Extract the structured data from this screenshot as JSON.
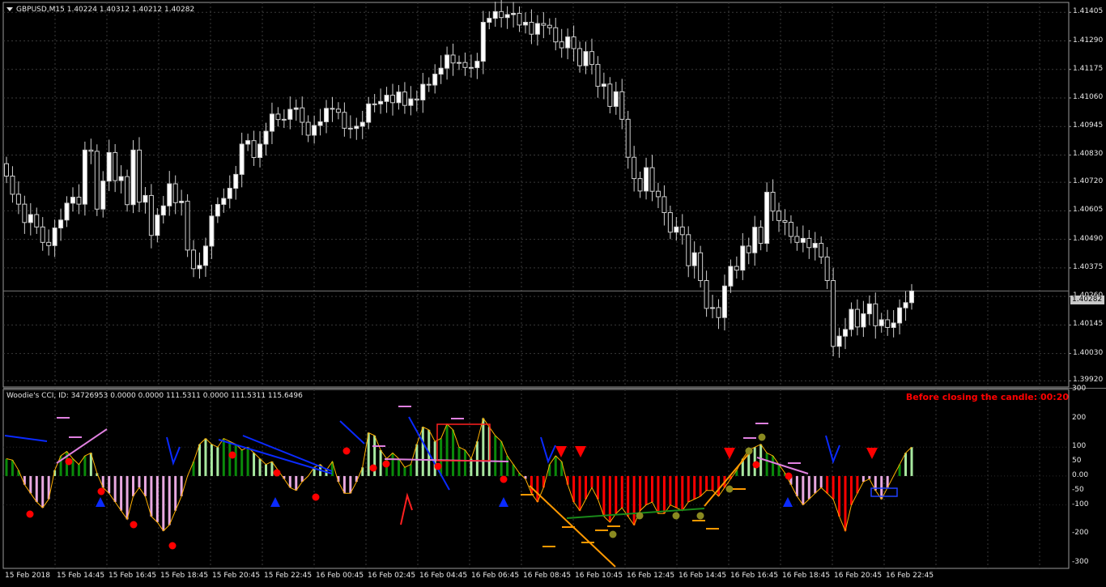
{
  "main_chart": {
    "title": "GBPUSD,M15  1.40224 1.40312 1.40212 1.40282",
    "current_price": "1.40282",
    "price_ticks": [
      "1.41405",
      "1.41290",
      "1.41175",
      "1.41060",
      "1.40945",
      "1.40830",
      "1.40720",
      "1.40605",
      "1.40490",
      "1.40375",
      "1.40260",
      "1.40145",
      "1.40030",
      "1.39920"
    ]
  },
  "indicator": {
    "title": "Woodie's CCI, ID: 34726953 0.0000 0.0000 111.5311 0.0000 111.5311 115.6496",
    "warning": "Before closing the candle: 00:20",
    "ticks": [
      "300",
      "200",
      "100",
      "50",
      "0.00",
      "-50",
      "-100",
      "-200",
      "-300"
    ]
  },
  "time_axis": [
    "15 Feb 2018",
    "15 Feb 14:45",
    "15 Feb 16:45",
    "15 Feb 18:45",
    "15 Feb 20:45",
    "15 Feb 22:45",
    "16 Feb 00:45",
    "16 Feb 02:45",
    "16 Feb 04:45",
    "16 Feb 06:45",
    "16 Feb 08:45",
    "16 Feb 10:45",
    "16 Feb 12:45",
    "16 Feb 14:45",
    "16 Feb 16:45",
    "16 Feb 18:45",
    "16 Feb 20:45",
    "16 Feb 22:45"
  ],
  "colors": {
    "bull": "#ffffff",
    "bear": "#000000",
    "grid": "#3a3a3a",
    "green": "#0a8a0a",
    "lightgreen": "#a8e8a0",
    "pink": "#e8a8e0",
    "red": "#ff0000",
    "orange": "#ff9900",
    "blue": "#0a2aff",
    "cci_line": "#ffb000"
  },
  "chart_data": {
    "type": "candlestick",
    "close": [
      1.40745,
      1.40672,
      1.40632,
      1.40558,
      1.4059,
      1.4054,
      1.40478,
      1.40465,
      1.40536,
      1.40568,
      1.40636,
      1.4066,
      1.40632,
      1.4085,
      1.40845,
      1.40612,
      1.40725,
      1.4084,
      1.40727,
      1.40743,
      1.4063,
      1.4085,
      1.4064,
      1.40667,
      1.40506,
      1.40588,
      1.40625,
      1.40714,
      1.40638,
      1.40644,
      1.40447,
      1.40372,
      1.40385,
      1.40463,
      1.40584,
      1.40631,
      1.40655,
      1.40696,
      1.40752,
      1.40874,
      1.40888,
      1.4082,
      1.40874,
      1.40926,
      1.40995,
      1.40973,
      1.40974,
      1.41014,
      1.4102,
      1.40962,
      1.4091,
      1.40949,
      1.40964,
      1.41018,
      1.41015,
      1.41002,
      1.40938,
      1.40937,
      1.40946,
      1.40962,
      1.41036,
      1.41036,
      1.41046,
      1.41071,
      1.41041,
      1.41084,
      1.4103,
      1.41056,
      1.41052,
      1.41115,
      1.41112,
      1.41156,
      1.4118,
      1.41233,
      1.41201,
      1.41203,
      1.41183,
      1.41182,
      1.41208,
      1.41365,
      1.41381,
      1.41408,
      1.41384,
      1.41396,
      1.41401,
      1.41354,
      1.41365,
      1.41317,
      1.4136,
      1.41353,
      1.41343,
      1.41286,
      1.41262,
      1.41306,
      1.41259,
      1.4119,
      1.41247,
      1.41195,
      1.41107,
      1.41116,
      1.41026,
      1.41085,
      1.40974,
      1.40821,
      1.40735,
      1.40685,
      1.40779,
      1.40684,
      1.40662,
      1.40598,
      1.40519,
      1.4054,
      1.40509,
      1.40384,
      1.40436,
      1.40324,
      1.40212,
      1.40215,
      1.40175,
      1.40302,
      1.40381,
      1.40366,
      1.40463,
      1.40436,
      1.40539,
      1.40474,
      1.4068,
      1.40604,
      1.40566,
      1.40559,
      1.40502,
      1.40478,
      1.40494,
      1.40457,
      1.40474,
      1.40419,
      1.40324,
      1.40059,
      1.401,
      1.40127,
      1.40208,
      1.40137,
      1.4019,
      1.4023,
      1.40142,
      1.40166,
      1.40135,
      1.40153,
      1.40214,
      1.40235,
      1.40282
    ],
    "open": [
      1.40795,
      1.40745,
      1.40672,
      1.40632,
      1.40558,
      1.4059,
      1.4054,
      1.40478,
      1.40465,
      1.40536,
      1.40568,
      1.40636,
      1.4066,
      1.40632,
      1.4085,
      1.40845,
      1.40612,
      1.40725,
      1.4084,
      1.40727,
      1.40743,
      1.4063,
      1.4085,
      1.4064,
      1.40667,
      1.40506,
      1.40588,
      1.40625,
      1.40714,
      1.40638,
      1.40644,
      1.40447,
      1.40372,
      1.40385,
      1.40463,
      1.40584,
      1.40631,
      1.40655,
      1.40696,
      1.40752,
      1.40874,
      1.40888,
      1.4082,
      1.40874,
      1.40926,
      1.40995,
      1.40973,
      1.40974,
      1.41014,
      1.4102,
      1.40962,
      1.4091,
      1.40949,
      1.40964,
      1.41018,
      1.41015,
      1.41002,
      1.40938,
      1.40937,
      1.40946,
      1.40962,
      1.41036,
      1.41036,
      1.41046,
      1.41071,
      1.41041,
      1.41084,
      1.4103,
      1.41056,
      1.41052,
      1.41115,
      1.41112,
      1.41156,
      1.4118,
      1.41233,
      1.41201,
      1.41203,
      1.41183,
      1.41182,
      1.41208,
      1.41365,
      1.41381,
      1.41408,
      1.41384,
      1.41396,
      1.41401,
      1.41354,
      1.41365,
      1.41317,
      1.4136,
      1.41353,
      1.41343,
      1.41286,
      1.41262,
      1.41306,
      1.41259,
      1.4119,
      1.41247,
      1.41195,
      1.41107,
      1.41116,
      1.41026,
      1.41085,
      1.40974,
      1.40821,
      1.40735,
      1.40685,
      1.40779,
      1.40684,
      1.40662,
      1.40598,
      1.40519,
      1.4054,
      1.40509,
      1.40384,
      1.40436,
      1.40324,
      1.40212,
      1.40215,
      1.40175,
      1.40302,
      1.40381,
      1.40366,
      1.40463,
      1.40436,
      1.40539,
      1.40474,
      1.4068,
      1.40604,
      1.40566,
      1.40559,
      1.40502,
      1.40478,
      1.40494,
      1.40457,
      1.40474,
      1.40419,
      1.40324,
      1.40059,
      1.401,
      1.40127,
      1.40208,
      1.40137,
      1.4019,
      1.4023,
      1.40142,
      1.40166,
      1.40135,
      1.40153,
      1.40214,
      1.40235
    ],
    "cci": [
      60,
      55,
      20,
      -30,
      -60,
      -90,
      -110,
      -80,
      20,
      70,
      85,
      60,
      40,
      70,
      80,
      10,
      -40,
      -60,
      -90,
      -120,
      -150,
      -70,
      -40,
      -70,
      -140,
      -160,
      -190,
      -170,
      -120,
      -70,
      0,
      50,
      110,
      130,
      110,
      100,
      130,
      120,
      110,
      90,
      100,
      80,
      60,
      40,
      50,
      20,
      -10,
      -40,
      -50,
      -20,
      0,
      30,
      40,
      20,
      50,
      -20,
      -60,
      -60,
      -20,
      30,
      150,
      140,
      90,
      60,
      80,
      60,
      30,
      40,
      110,
      170,
      160,
      120,
      130,
      180,
      160,
      100,
      90,
      60,
      120,
      200,
      170,
      140,
      120,
      70,
      40,
      10,
      -10,
      -60,
      -90,
      -40,
      40,
      70,
      50,
      -30,
      -90,
      -120,
      -80,
      -40,
      -80,
      -140,
      -160,
      -130,
      -110,
      -140,
      -170,
      -120,
      -100,
      -90,
      -130,
      -130,
      -100,
      -110,
      -120,
      -90,
      -80,
      -70,
      -50,
      -50,
      -70,
      -40,
      -10,
      20,
      60,
      90,
      100,
      110,
      80,
      70,
      40,
      10,
      -30,
      -70,
      -100,
      -80,
      -60,
      -40,
      -60,
      -80,
      -140,
      -190,
      -100,
      -60,
      -20,
      -10,
      -50,
      -80,
      -40,
      0,
      40,
      80,
      100,
      115.65
    ]
  }
}
